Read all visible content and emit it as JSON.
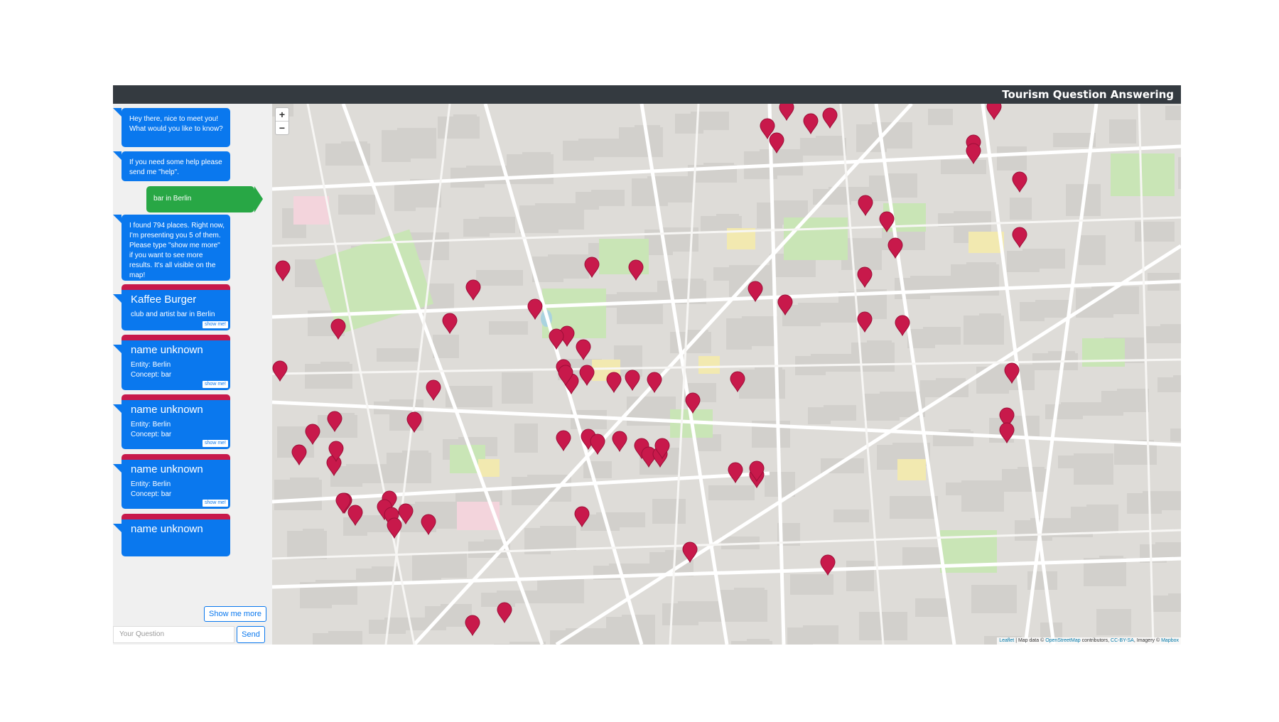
{
  "header": {
    "title": "Tourism Question Answering"
  },
  "chat": {
    "messages": [
      {
        "from": "bot",
        "text": "Hey there, nice to meet you! What would you like to know?"
      },
      {
        "from": "bot",
        "text": "If you need some help please send me \"help\"."
      },
      {
        "from": "user",
        "text": "bar in Berlin"
      },
      {
        "from": "bot",
        "text": "I found 794 places. Right now, I'm presenting you 5 of them. Please type \"show me more\" if you want to see more results. It's all visible on the map!"
      }
    ],
    "results": [
      {
        "name": "Kaffee Burger",
        "lines": [
          "club and artist bar in Berlin"
        ],
        "button": "show me!"
      },
      {
        "name": "name unknown",
        "lines": [
          "Entity: Berlin",
          "Concept: bar"
        ],
        "button": "show me!"
      },
      {
        "name": "name unknown",
        "lines": [
          "Entity: Berlin",
          "Concept: bar"
        ],
        "button": "show me!"
      },
      {
        "name": "name unknown",
        "lines": [
          "Entity: Berlin",
          "Concept: bar"
        ],
        "button": "show me!"
      },
      {
        "name": "name unknown",
        "lines": [],
        "button": ""
      }
    ],
    "show_more_label": "Show me more",
    "input_placeholder": "Your Question",
    "send_label": "Send"
  },
  "map": {
    "zoom_in": "+",
    "zoom_out": "−",
    "attribution": {
      "leaflet": "Leaflet",
      "text1": " | Map data © ",
      "osm": "OpenStreetMap",
      "text2": " contributors, ",
      "license": "CC-BY-SA",
      "text3": ", Imagery © ",
      "provider": "Mapbox"
    },
    "marker_color": "#c8194b",
    "marker_icon": "map-pin-icon"
  }
}
